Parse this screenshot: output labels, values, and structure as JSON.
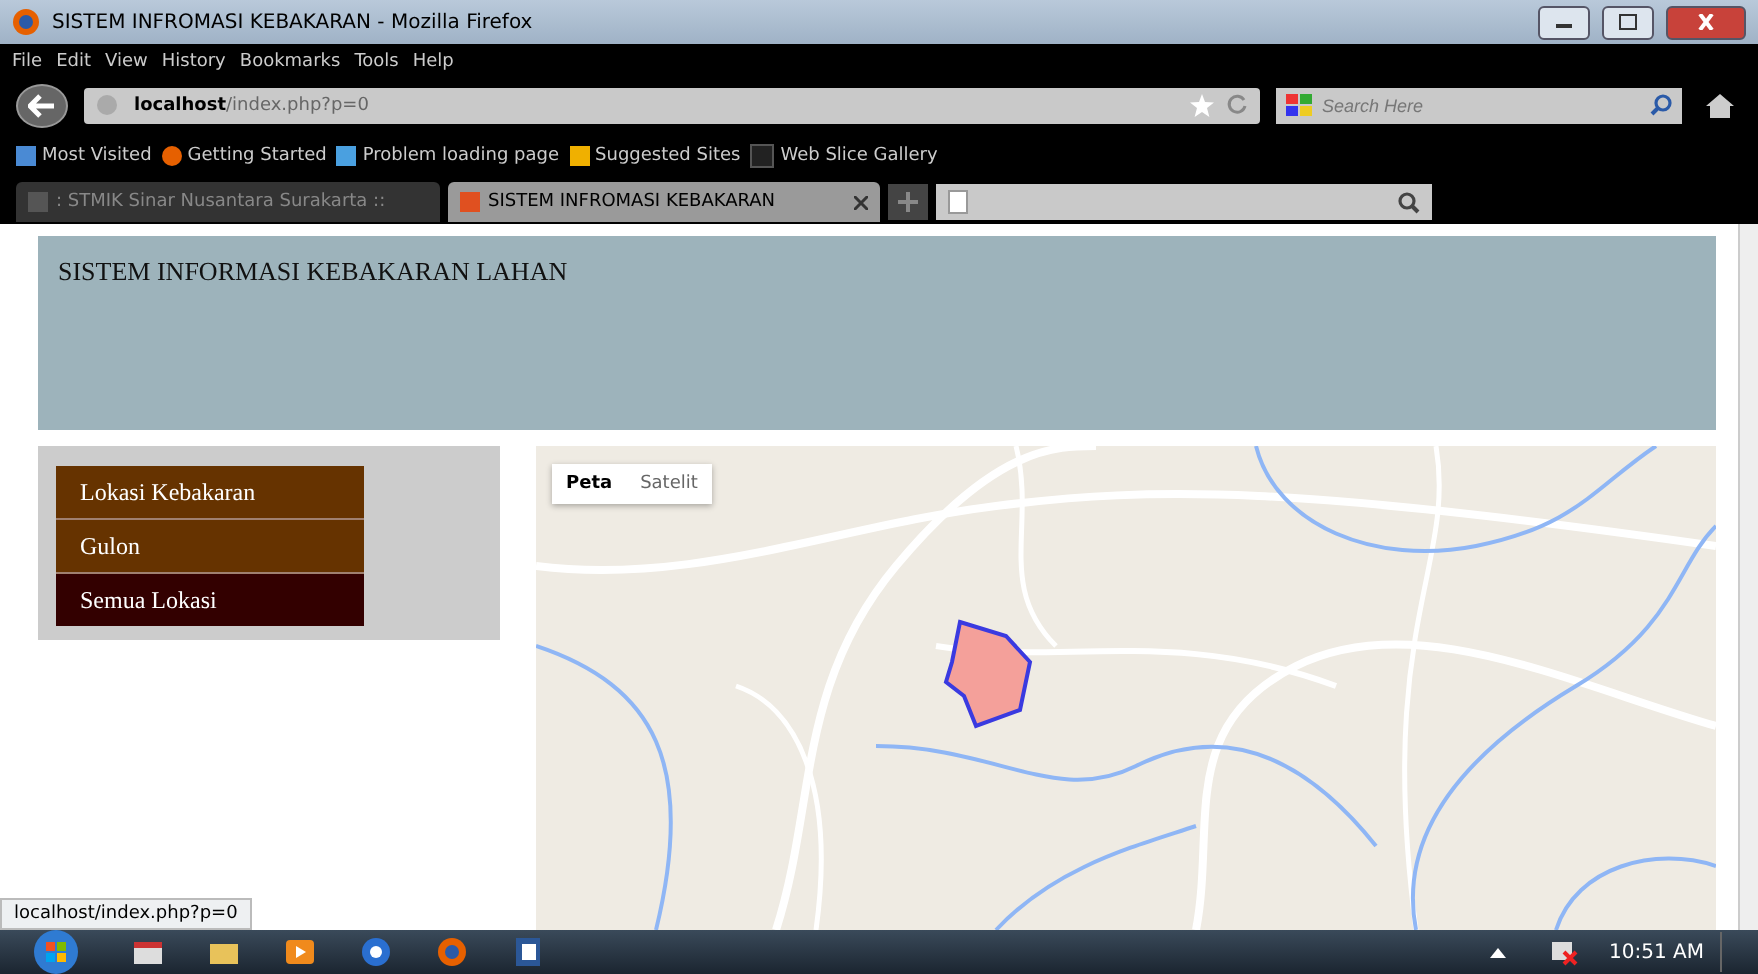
{
  "window": {
    "title": "SISTEM INFROMASI KEBAKARAN - Mozilla Firefox"
  },
  "menu_bar": [
    "File",
    "Edit",
    "View",
    "History",
    "Bookmarks",
    "Tools",
    "Help"
  ],
  "address_bar": {
    "host": "localhost",
    "path": "/index.php?p=0"
  },
  "search": {
    "placeholder": "Search Here"
  },
  "bookmarks": [
    "Most Visited",
    "Getting Started",
    "Problem loading page",
    "Suggested Sites",
    "Web Slice Gallery"
  ],
  "tabs": [
    {
      "label": ": STMIK Sinar Nusantara Surakarta ::",
      "selected": false
    },
    {
      "label": "SISTEM INFROMASI KEBAKARAN",
      "selected": true
    }
  ],
  "page": {
    "header": "SISTEM INFORMASI KEBAKARAN LAHAN",
    "sidebar": [
      {
        "label": "Lokasi Kebakaran",
        "selected": false
      },
      {
        "label": "Gulon",
        "selected": false
      },
      {
        "label": "Semua Lokasi",
        "selected": true
      }
    ],
    "map": {
      "kind": "picture",
      "map_types": [
        {
          "label": "Peta",
          "selected": true
        },
        {
          "label": "Satelit",
          "selected": false
        }
      ]
    }
  },
  "status_bar": "localhost/index.php?p=0",
  "taskbar": {
    "clock": "10:51 AM"
  }
}
